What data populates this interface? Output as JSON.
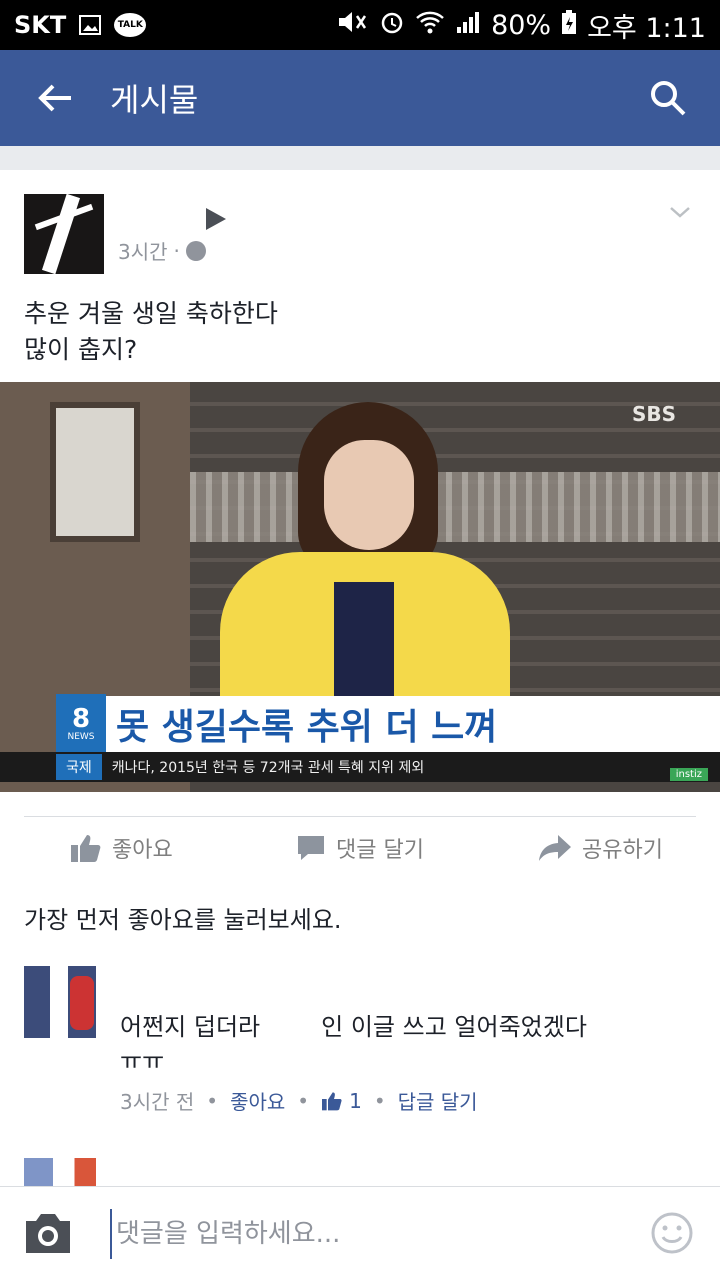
{
  "status_bar": {
    "carrier": "SKT",
    "talk": "TALK",
    "battery": "80%",
    "time": "오후 1:11"
  },
  "app_bar": {
    "title": "게시물"
  },
  "post": {
    "time": "3시간",
    "text_line1": "추운 겨울 생일 축하한다",
    "text_line2": "많이 춥지?",
    "image": {
      "watermark": "SBS",
      "news_number": "8",
      "news_label": "NEWS",
      "headline": "못 생길수록 추위 더 느껴",
      "ticker_tag": "국제",
      "ticker_text": "캐나다, 2015년 한국 등 72개국 관세 특혜 지위 제외",
      "source_tag": "instiz"
    }
  },
  "actions": {
    "like": "좋아요",
    "comment": "댓글 달기",
    "share": "공유하기"
  },
  "first_like_prompt": "가장 먼저 좋아요를 눌러보세요.",
  "comment": {
    "text": "어쩐지 덥더라        인 이글 쓰고 얼어죽었겠다\nㅠㅠ",
    "time": "3시간 전",
    "like": "좋아요",
    "like_count": "1",
    "reply": "답글 달기"
  },
  "composer": {
    "placeholder": "댓글을 입력하세요..."
  },
  "colors": {
    "brand": "#3b5998",
    "status_bar": "#000000"
  }
}
